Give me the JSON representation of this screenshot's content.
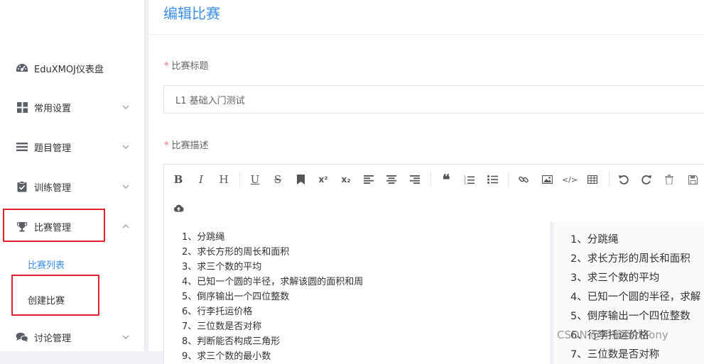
{
  "sidebar": {
    "items": [
      {
        "label": "EduXMOJ仪表盘",
        "icon": "dashboard-icon",
        "has_chevron": false
      },
      {
        "label": "常用设置",
        "icon": "grid-icon",
        "has_chevron": true
      },
      {
        "label": "题目管理",
        "icon": "list-icon",
        "has_chevron": true
      },
      {
        "label": "训练管理",
        "icon": "clipboard-icon",
        "has_chevron": true
      },
      {
        "label": "比赛管理",
        "icon": "trophy-icon",
        "has_chevron": true,
        "expanded": true
      },
      {
        "label": "讨论管理",
        "icon": "comments-icon",
        "has_chevron": true
      }
    ],
    "submenu": [
      {
        "label": "比赛列表",
        "active": true
      },
      {
        "label": "创建比赛",
        "active": false
      }
    ],
    "active_color": "#3a8ee6"
  },
  "main": {
    "title": "编辑比赛",
    "title_field": {
      "label": "比赛标题",
      "required_mark": "*",
      "value": "L1 基础入门测试"
    },
    "desc_field": {
      "label": "比赛描述",
      "required_mark": "*"
    },
    "editor": {
      "toolbar": [
        "bold-icon",
        "italic-icon",
        "header-icon",
        "underline-icon",
        "strikethrough-icon",
        "bookmark-icon",
        "superscript-icon",
        "subscript-icon",
        "align-left-icon",
        "align-center-icon",
        "align-right-icon",
        "quote-icon",
        "ordered-list-icon",
        "unordered-list-icon",
        "link-icon",
        "image-icon",
        "code-icon",
        "table-icon",
        "undo-icon",
        "redo-icon",
        "trash-icon",
        "save-icon",
        "cloud-upload-icon"
      ],
      "source_lines": [
        "1、分跳绳",
        "2、求长方形的周长和面积",
        "3、求三个数的平均",
        "4、已知一个圆的半径，求解该圆的面积和周",
        "5、倒序输出一个四位整数",
        "6、行李托运价格",
        "7、三位数是否对称",
        "8、判断能否构成三角形",
        "9、求三个数的最小数"
      ],
      "preview_lines": [
        "1、分跳绳",
        "2、求长方形的周长和面积",
        "3、求三个数的平均",
        "4、已知一个圆的半径，求解",
        "5、倒序输出一个四位整数",
        "6、行李托运价格",
        "7、三位数是否对称"
      ]
    }
  },
  "watermark": "CSDN @手编程找Tony",
  "colors": {
    "accent": "#3a8ee6",
    "required": "#f56c6c",
    "highlight_box": "#e0212b"
  }
}
